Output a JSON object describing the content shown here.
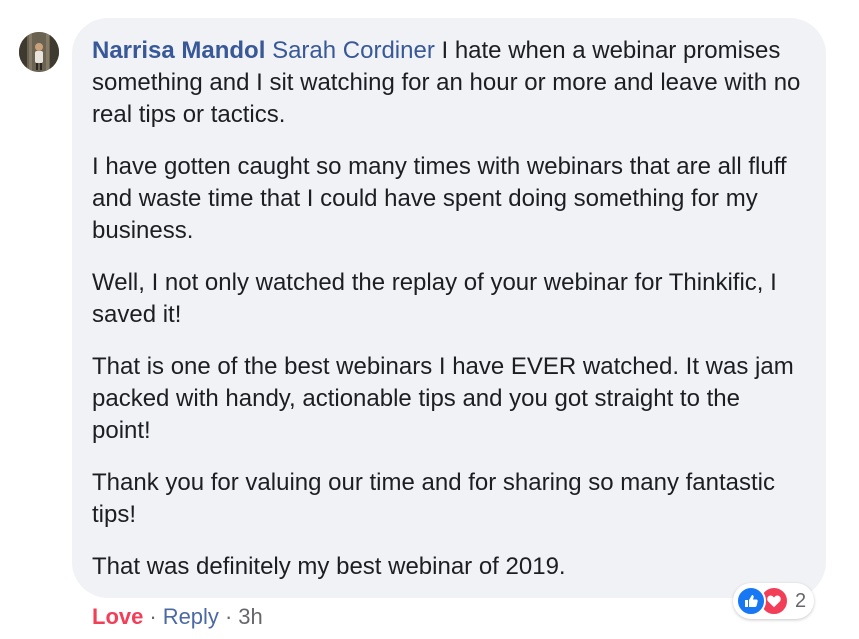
{
  "comment": {
    "author": "Narrisa Mandol",
    "mention": "Sarah Cordiner",
    "first_paragraph_text": " I hate when a webinar promises something and I sit watching for an hour or more and leave with no real tips or tactics.",
    "paragraphs": [
      "I have gotten caught so many times with webinars that are all fluff and waste time that I could have spent doing something for my business.",
      "Well, I not only watched the replay of your webinar for Thinkific, I saved it!",
      "That is one of the best webinars I have EVER watched. It was jam packed with handy, actionable tips and you got straight to the point!",
      "Thank you for valuing our time and for sharing so many fantastic tips!",
      "That was definitely my best webinar of 2019."
    ]
  },
  "reactions": {
    "icons": [
      "like-icon",
      "love-icon"
    ],
    "count": "2"
  },
  "actions": {
    "love_label": "Love",
    "separator": "·",
    "reply_label": "Reply",
    "timestamp": "3h"
  },
  "colors": {
    "bubble_bg": "#f0f2f5",
    "link_blue": "#385898",
    "love_red": "#f33e58",
    "like_blue": "#1877f2",
    "meta_gray": "#65676b",
    "text": "#1c1e21"
  }
}
